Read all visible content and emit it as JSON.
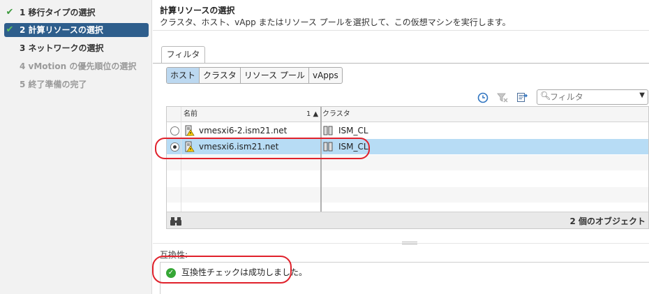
{
  "wizard_steps": [
    {
      "label": "1 移行タイプの選択",
      "done": true,
      "active": false,
      "disabled": false
    },
    {
      "label": "2 計算リソースの選択",
      "done": true,
      "active": true,
      "disabled": false
    },
    {
      "label": "3 ネットワークの選択",
      "done": false,
      "active": false,
      "disabled": false
    },
    {
      "label": "4 vMotion の優先順位の選択",
      "done": false,
      "active": false,
      "disabled": true
    },
    {
      "label": "5 終了準備の完了",
      "done": false,
      "active": false,
      "disabled": true
    }
  ],
  "main": {
    "title": "計算リソースの選択",
    "description": "クラスタ、ホスト、vApp またはリソース プールを選択して、この仮想マシンを実行します。"
  },
  "filter": {
    "tab_label": "フィルタ",
    "segments": [
      {
        "label": "ホスト",
        "active": true
      },
      {
        "label": "クラスタ",
        "active": false
      },
      {
        "label": "リソース プール",
        "active": false
      },
      {
        "label": "vApps",
        "active": false
      }
    ],
    "search_placeholder": "フィルタ"
  },
  "grid": {
    "columns": {
      "name": "名前",
      "sort_indicator": "1 ▲",
      "cluster": "クラスタ"
    },
    "rows": [
      {
        "name": "vmesxi6-2.ism21.net",
        "cluster": "ISM_CL",
        "selected": false
      },
      {
        "name": "vmesxi6.ism21.net",
        "cluster": "ISM_CL",
        "selected": true
      }
    ],
    "footer_count": "2 個のオブジェクト"
  },
  "compatibility": {
    "label": "互換性:",
    "message": "互換性チェックは成功しました。"
  },
  "colors": {
    "active_step_bg": "#2e5e8c",
    "selected_row_bg": "#b7dcf5",
    "success_green": "#36a736",
    "annotation_red": "#e0212b"
  }
}
